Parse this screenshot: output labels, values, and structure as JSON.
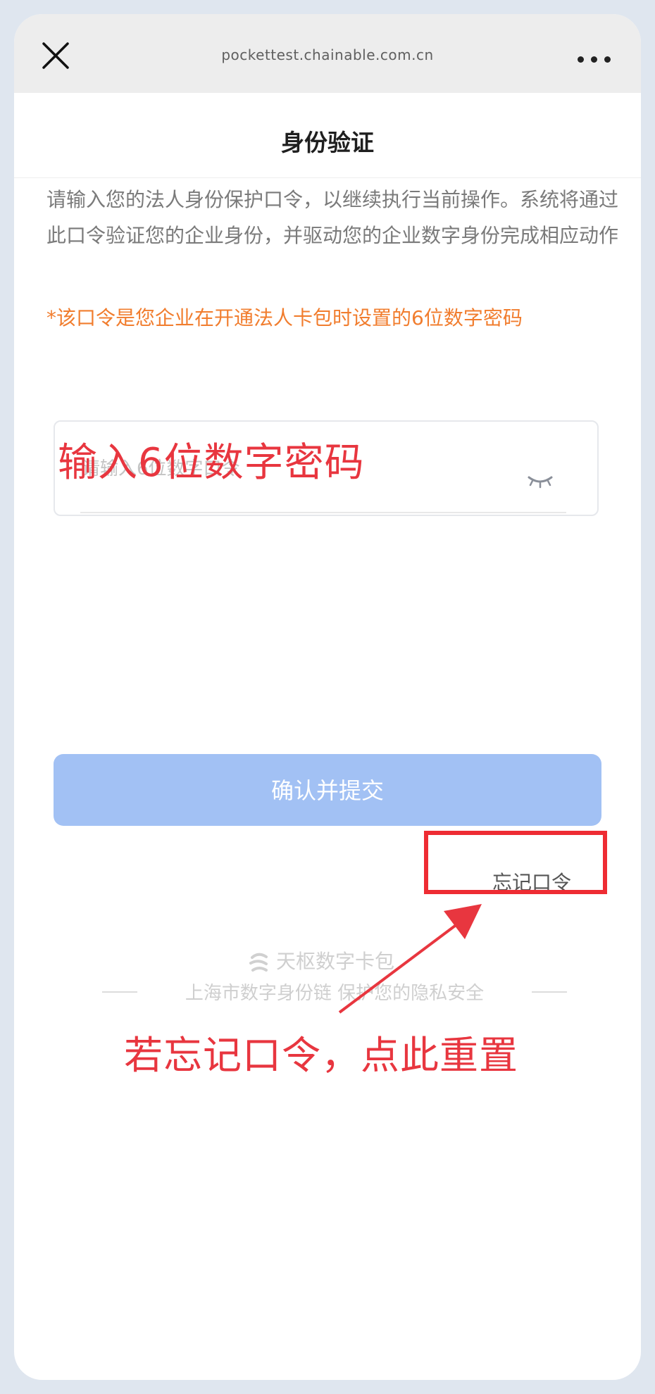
{
  "browser": {
    "url": "pockettest.chainable.com.cn"
  },
  "header": {
    "title": "身份验证"
  },
  "main": {
    "description": "请输入您的法人身份保护口令，以继续执行当前操作。系统将通过此口令验证您的企业身份，并驱动您的企业数字身份完成相应动作",
    "notice": "*该口令是您企业在开通法人卡包时设置的6位数字密码",
    "password_field": {
      "placeholder": "请输入6位数字口令",
      "value": ""
    },
    "submit_label": "确认并提交",
    "forgot_label": "忘记口令"
  },
  "footer": {
    "brand": "天枢数字卡包",
    "tagline": "上海市数字身份链 保护您的隐私安全"
  },
  "annotations": {
    "input_hint": "输入6位数字密码",
    "forgot_hint": "若忘记口令，点此重置",
    "color": "#e8363f"
  },
  "colors": {
    "accent_button": "#a2c1f4",
    "notice_text": "#f17d2e",
    "annotation": "#e8363f"
  },
  "icons": [
    "close-icon",
    "more-icon",
    "eye-closed-icon",
    "brand-logo-icon"
  ]
}
